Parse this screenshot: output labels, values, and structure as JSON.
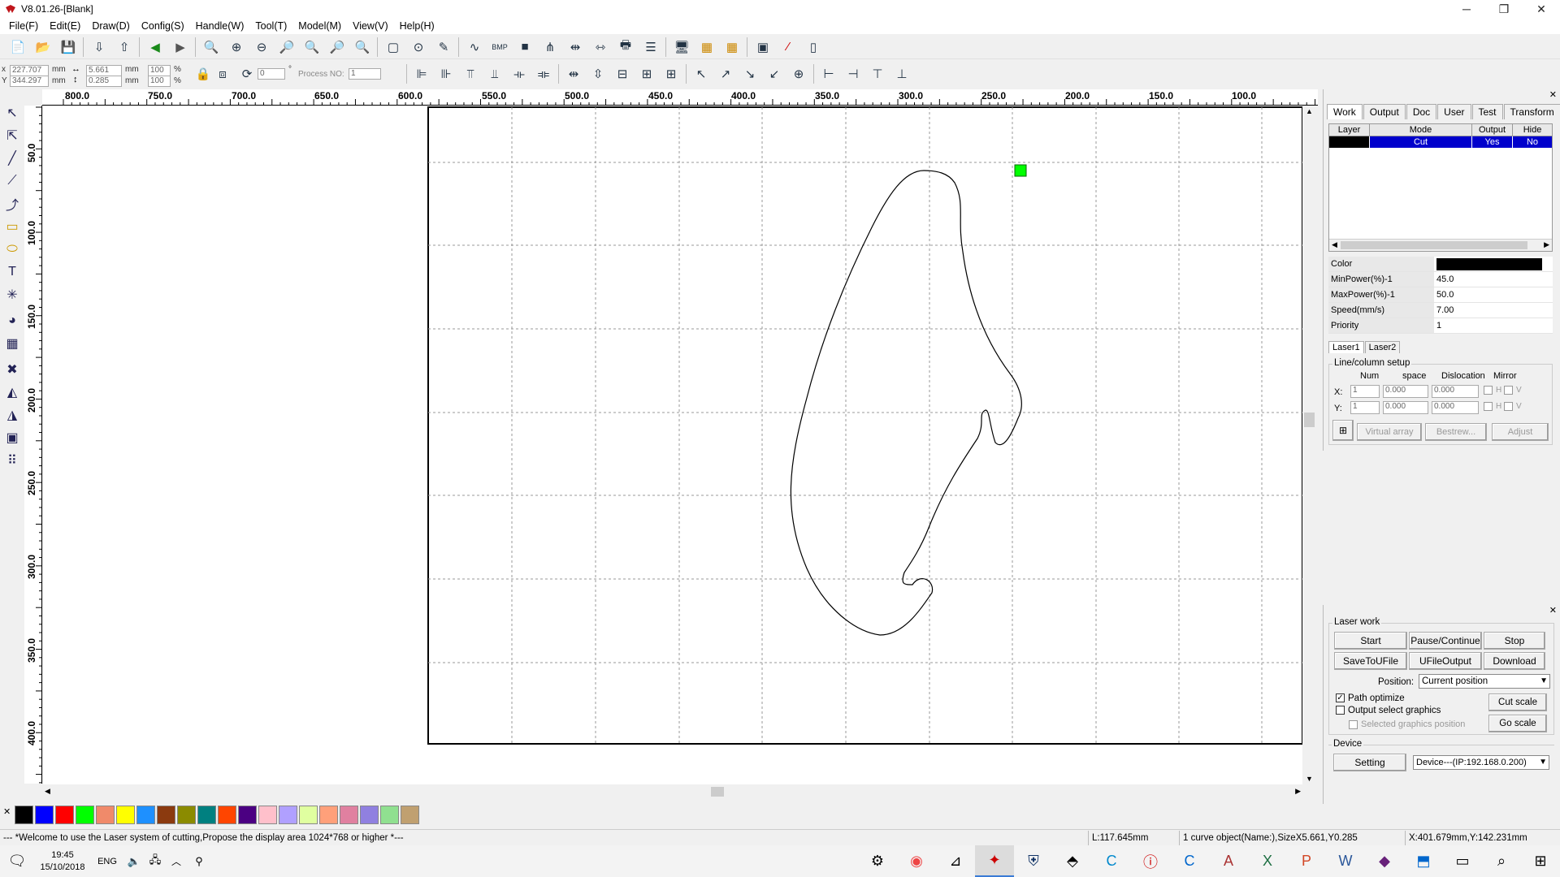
{
  "app": {
    "title": "V8.01.26-[Blank]"
  },
  "menu": [
    "File(F)",
    "Edit(E)",
    "Draw(D)",
    "Config(S)",
    "Handle(W)",
    "Tool(T)",
    "Model(M)",
    "View(V)",
    "Help(H)"
  ],
  "coords": {
    "x_label": "x",
    "y_label": "Y",
    "x": "227.707",
    "y": "344.297",
    "unit": "mm",
    "width": "5.661",
    "height": "0.285",
    "scale_w": "100",
    "scale_h": "100",
    "pct": "%",
    "rotate": "0",
    "deg": "°",
    "process_label": "Process NO:",
    "process_no": "1"
  },
  "ruler": {
    "h": [
      "800.0",
      "750.0",
      "700.0",
      "650.0",
      "600.0",
      "550.0",
      "500.0",
      "450.0",
      "400.0",
      "350.0",
      "300.0",
      "250.0",
      "200.0",
      "150.0",
      "100.0"
    ],
    "v": [
      "50.0",
      "100.0",
      "150.0",
      "200.0",
      "250.0",
      "300.0",
      "350.0",
      "400.0"
    ]
  },
  "panel": {
    "tabs": [
      "Work",
      "Output",
      "Doc",
      "User",
      "Test",
      "Transform"
    ],
    "layer_headers": [
      "Layer",
      "Mode",
      "Output",
      "Hide"
    ],
    "layer_row": {
      "mode": "Cut",
      "output": "Yes",
      "hide": "No",
      "color": "#000000"
    },
    "props": [
      {
        "k": "Color",
        "v": ""
      },
      {
        "k": "MinPower(%)-1",
        "v": "45.0"
      },
      {
        "k": "MaxPower(%)-1",
        "v": "50.0"
      },
      {
        "k": "Speed(mm/s)",
        "v": "7.00"
      },
      {
        "k": "Priority",
        "v": "1"
      }
    ],
    "laser_tabs": [
      "Laser1",
      "Laser2"
    ],
    "linecol": {
      "title": "Line/column setup",
      "num": "Num",
      "space": "space",
      "dislocation": "Dislocation",
      "mirror": "Mirror",
      "x": "X:",
      "y": "Y:",
      "xnum": "1",
      "ynum": "1",
      "xspace": "0.000",
      "yspace": "0.000",
      "xdis": "0.000",
      "ydis": "0.000",
      "h": "H",
      "v": "V",
      "virtual": "Virtual array",
      "bestrew": "Bestrew...",
      "adjust": "Adjust"
    }
  },
  "laserwork": {
    "title": "Laser work",
    "start": "Start",
    "pause": "Pause/Continue",
    "stop": "Stop",
    "save": "SaveToUFile",
    "ufile": "UFileOutput",
    "download": "Download",
    "position_label": "Position:",
    "position": "Current position",
    "path_opt": "Path optimize",
    "output_sel": "Output select graphics",
    "sel_pos": "Selected graphics position",
    "cut_scale": "Cut scale",
    "go_scale": "Go scale"
  },
  "device": {
    "title": "Device",
    "setting": "Setting",
    "device": "Device---(IP:192.168.0.200)"
  },
  "palette": [
    "#000000",
    "#0000ff",
    "#ff0000",
    "#00ff00",
    "#f08a6a",
    "#ffff00",
    "#1e90ff",
    "#8b3a0f",
    "#8b8b00",
    "#008080",
    "#ff4500",
    "#4b0082",
    "#ffc0cb",
    "#b0a0ff",
    "#e0ffa0",
    "#ffa07a",
    "#e080a0",
    "#9080e0",
    "#90e090",
    "#c0a070"
  ],
  "status": {
    "welcome": "--- *Welcome to use the Laser system of cutting,Propose the display area 1024*768 or higher *---",
    "length": "L:117.645mm",
    "selection": "1 curve object(Name:),SizeX5.661,Y0.285",
    "position": "X:401.679mm,Y:142.231mm"
  },
  "taskbar": {
    "lang": "ENG",
    "time": "19:45",
    "date": "15/10/2018"
  },
  "colors": {
    "selection": "#0000cc",
    "green_marker": "#00ff00"
  }
}
